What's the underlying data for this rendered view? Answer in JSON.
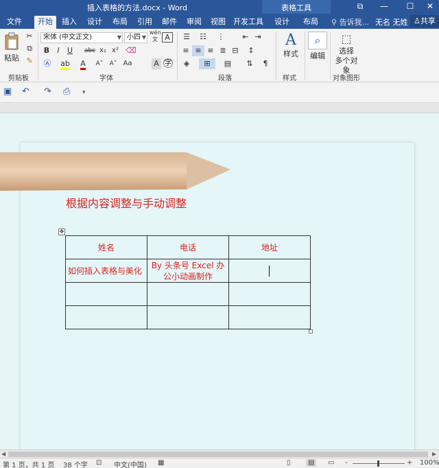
{
  "window": {
    "title": "插入表格的方法.docx - Word",
    "contextual_tools": "表格工具",
    "controls": {
      "restore": "⧉",
      "minimize": "—",
      "maximize": "☐",
      "close": "✕"
    }
  },
  "tabs": {
    "file": "文件",
    "home": "开始",
    "insert": "插入",
    "design": "设计",
    "layout": "布局",
    "references": "引用",
    "mailings": "邮件",
    "review": "审阅",
    "view": "视图",
    "developer": "开发工具",
    "table_design": "设计",
    "table_layout": "布局",
    "tell_me": "告诉我...",
    "user": "无名 无姓",
    "share": "共享"
  },
  "ribbon": {
    "clipboard": {
      "paste": "粘贴",
      "group": "剪贴板"
    },
    "font": {
      "font_name": "宋体 (中文正文)",
      "font_size": "小四",
      "wen": "wén",
      "bold": "B",
      "italic": "I",
      "underline": "U",
      "strike": "abc",
      "subscript": "x₂",
      "superscript": "x²",
      "grow": "A˄",
      "shrink": "A˅",
      "aa": "Aa",
      "group": "字体"
    },
    "paragraph": {
      "group": "段落"
    },
    "styles": {
      "label": "样式",
      "group": "样式"
    },
    "editing": {
      "label": "编辑"
    },
    "select": {
      "line1": "选择",
      "line2": "多个对象",
      "group": "对象图形"
    }
  },
  "document": {
    "heading": "根据内容调整与手动调整",
    "table": {
      "headers": [
        "姓名",
        "电话",
        "地址"
      ],
      "row1": [
        "如何插入表格与美化",
        "By 头条号 Excel 办公小动画制作",
        ""
      ]
    }
  },
  "statusbar": {
    "page": "第 1 页，共 1 页",
    "words": "38 个字",
    "language": "中文(中国)",
    "zoom_minus": "-",
    "zoom_plus": "+",
    "zoom": "100%"
  },
  "colors": {
    "accent": "#2b579a",
    "doc_red": "#e0201f",
    "page_bg": "#e4f6f8"
  }
}
